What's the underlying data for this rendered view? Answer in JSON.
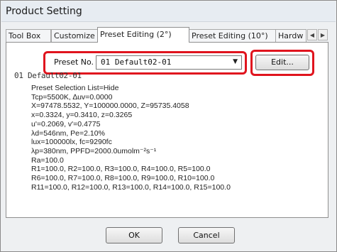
{
  "window": {
    "title": "Product Setting"
  },
  "tabs": [
    {
      "label": "Tool Box"
    },
    {
      "label": "Customize"
    },
    {
      "label": "Preset Editing (2°)"
    },
    {
      "label": "Preset Editing (10°)"
    },
    {
      "label": "Hardw"
    }
  ],
  "tab_scroll": {
    "left": "◀",
    "right": "▶"
  },
  "preset": {
    "label": "Preset No.",
    "selected": "01 Default02-01",
    "edit_label": "Edit..."
  },
  "current_preset_heading": "01 Default02-01",
  "info_lines": [
    "Preset Selection List=Hide",
    "Tcp=5500K, ∆uv=0.0000",
    "X=97478.5532, Y=100000.0000, Z=95735.4058",
    "x=0.3324, y=0.3410, z=0.3265",
    "u'=0.2069, v'=0.4775",
    "λd=546nm, Pe=2.10%",
    "lux=100000lx, fc=9290fc",
    "λp=380nm, PPFD=2000.0umolm⁻²s⁻¹",
    "Ra=100.0",
    "R1=100.0, R2=100.0, R3=100.0, R4=100.0, R5=100.0",
    "R6=100.0, R7=100.0, R8=100.0, R9=100.0, R10=100.0",
    "R11=100.0, R12=100.0, R13=100.0, R14=100.0, R15=100.0"
  ],
  "buttons": {
    "ok": "OK",
    "cancel": "Cancel"
  },
  "colors": {
    "highlight": "#e0141e"
  }
}
